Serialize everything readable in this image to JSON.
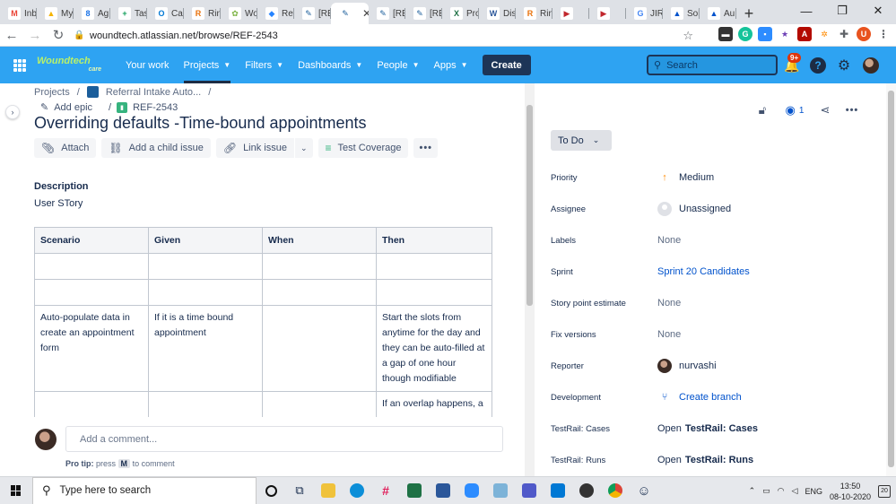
{
  "browser": {
    "tabs": [
      {
        "label": "Inb",
        "fav_color": "#EA4335",
        "glyph": "M"
      },
      {
        "label": "My",
        "fav_color": "#F4B400",
        "glyph": "▲"
      },
      {
        "label": "Ag",
        "fav_color": "#1a73e8",
        "glyph": "8"
      },
      {
        "label": "Tas",
        "fav_color": "#0f9d58",
        "glyph": "+"
      },
      {
        "label": "Cal",
        "fav_color": "#0078d4",
        "glyph": "O"
      },
      {
        "label": "Rin",
        "fav_color": "#e8710a",
        "glyph": "R"
      },
      {
        "label": "Wo",
        "fav_color": "#7cb342",
        "glyph": "✿"
      },
      {
        "label": "Ref",
        "fav_color": "#2684FF",
        "glyph": "◆"
      },
      {
        "label": "[RE",
        "fav_color": "#1b5e9b",
        "glyph": "✎"
      },
      {
        "label": "",
        "fav_color": "#1b5e9b",
        "glyph": "✎",
        "active": true
      },
      {
        "label": "[RE",
        "fav_color": "#1b5e9b",
        "glyph": "✎"
      },
      {
        "label": "[RE",
        "fav_color": "#1b5e9b",
        "glyph": "✎"
      },
      {
        "label": "Pro",
        "fav_color": "#1e7145",
        "glyph": "X"
      },
      {
        "label": "Dis",
        "fav_color": "#2b579a",
        "glyph": "W"
      },
      {
        "label": "Rin",
        "fav_color": "#e8710a",
        "glyph": "R"
      },
      {
        "label": "",
        "fav_color": "#c1272d",
        "glyph": "▶"
      },
      {
        "label": "",
        "fav_color": "#c1272d",
        "glyph": "▶"
      },
      {
        "label": "JIR",
        "fav_color": "#4285F4",
        "glyph": "G"
      },
      {
        "label": "Sol",
        "fav_color": "#0052CC",
        "glyph": "▲"
      },
      {
        "label": "Au",
        "fav_color": "#0052CC",
        "glyph": "▲"
      }
    ],
    "url": "woundtech.atlassian.net/browse/REF-2543"
  },
  "jira_nav": {
    "logo_text": "Woundtech",
    "logo_sub": "care",
    "items": [
      {
        "label": "Your work",
        "has_dropdown": false
      },
      {
        "label": "Projects",
        "has_dropdown": true,
        "active": true
      },
      {
        "label": "Filters",
        "has_dropdown": true
      },
      {
        "label": "Dashboards",
        "has_dropdown": true
      },
      {
        "label": "People",
        "has_dropdown": true
      },
      {
        "label": "Apps",
        "has_dropdown": true
      }
    ],
    "create_label": "Create",
    "search_placeholder": "Search",
    "notification_count": "9+"
  },
  "breadcrumb": {
    "projects": "Projects",
    "project_name": "Referral Intake Auto...",
    "add_epic": "Add epic",
    "issue_key": "REF-2543"
  },
  "issue": {
    "title": "Overriding defaults -Time-bound appointments",
    "toolbar": {
      "attach": "Attach",
      "add_child": "Add a child issue",
      "link_issue": "Link issue",
      "test_coverage": "Test Coverage"
    },
    "description_label": "Description",
    "description_text": "User STory",
    "table": {
      "headers": [
        "Scenario",
        "Given",
        "When",
        "Then"
      ],
      "rows": [
        [
          "",
          "",
          "",
          ""
        ],
        [
          "",
          "",
          "",
          ""
        ],
        [
          "Auto-populate data in create an appointment form",
          "If it is a time bound appointment",
          "",
          "Start the slots from anytime for the day and they can be auto-filled at a gap of one hour though modifiable"
        ],
        [
          "",
          "",
          "",
          "If an overlap happens, a"
        ]
      ]
    },
    "comment_placeholder": "Add a comment...",
    "protip_prefix": "Pro tip:",
    "protip_press": "press",
    "protip_key": "M",
    "protip_suffix": "to comment"
  },
  "details": {
    "watchers": "1",
    "status": "To Do",
    "fields": [
      {
        "label": "Priority",
        "value": "Medium"
      },
      {
        "label": "Assignee",
        "value": "Unassigned"
      },
      {
        "label": "Labels",
        "value": "None"
      },
      {
        "label": "Sprint",
        "value": "Sprint 20 Candidates"
      },
      {
        "label": "Story point estimate",
        "value": "None"
      },
      {
        "label": "Fix versions",
        "value": "None"
      },
      {
        "label": "Reporter",
        "value": "nurvashi"
      },
      {
        "label": "Development",
        "value": "Create branch"
      },
      {
        "label": "TestRail: Cases",
        "value_prefix": "Open",
        "value": "TestRail: Cases"
      },
      {
        "label": "TestRail: Runs",
        "value_prefix": "Open",
        "value": "TestRail: Runs"
      }
    ]
  },
  "taskbar": {
    "search_placeholder": "Type here to search",
    "language": "ENG",
    "time": "13:50",
    "date": "08-10-2020",
    "notification_count": "20"
  }
}
